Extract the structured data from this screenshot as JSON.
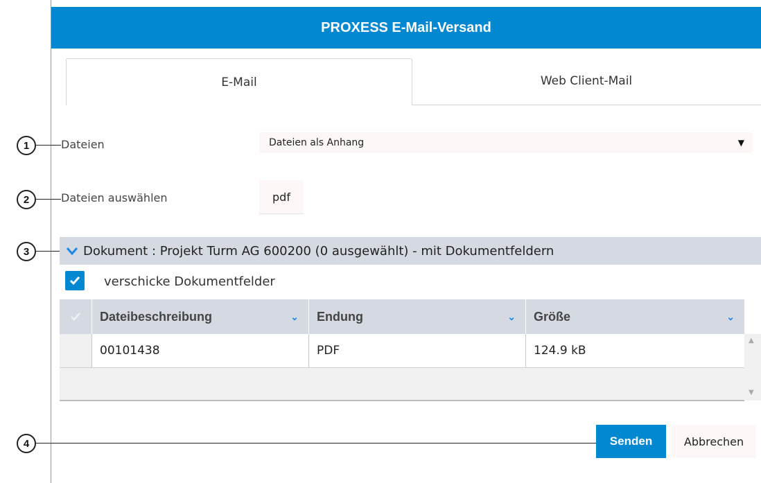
{
  "window": {
    "title": "PROXESS E-Mail-Versand"
  },
  "tabs": [
    {
      "label": "E-Mail",
      "active": true
    },
    {
      "label": "Web Client-Mail",
      "active": false
    }
  ],
  "callouts": [
    "1",
    "2",
    "3",
    "4"
  ],
  "form": {
    "files_label": "Dateien",
    "files_select_value": "Dateien als Anhang",
    "select_arrow": "▼",
    "choose_files_label": "Dateien auswählen",
    "choose_files_button": "pdf"
  },
  "group": {
    "title": "Dokument : Projekt Turm AG 600200 (0 ausgewählt) - mit Dokumentfeldern",
    "expanded": true
  },
  "send_fields": {
    "label": "verschicke Dokumentfelder",
    "checked": true
  },
  "table": {
    "columns": [
      "Dateibeschreibung",
      "Endung",
      "Größe"
    ],
    "rows": [
      [
        "00101438",
        "PDF",
        "124.9 kB"
      ]
    ]
  },
  "actions": {
    "send": "Senden",
    "cancel": "Abbrechen"
  },
  "colors": {
    "accent": "#0288d1",
    "header_bg": "#d4d9e2"
  }
}
